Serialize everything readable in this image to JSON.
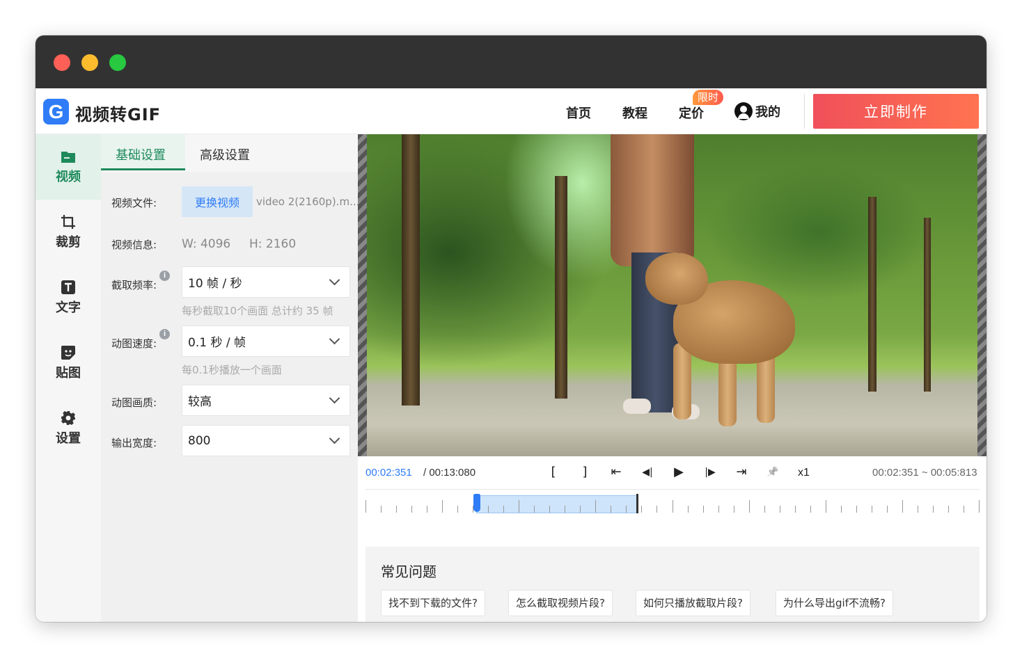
{
  "app": {
    "logo_letter": "G",
    "name": "视频转GIF"
  },
  "nav": {
    "home": "首页",
    "tutorial": "教程",
    "pricing": "定价",
    "pricing_badge": "限时",
    "mine": "我的",
    "cta": "立即制作"
  },
  "rail": [
    {
      "label": "视频",
      "icon": "folder-icon",
      "active": true
    },
    {
      "label": "裁剪",
      "icon": "crop-icon"
    },
    {
      "label": "文字",
      "icon": "text-icon"
    },
    {
      "label": "贴图",
      "icon": "sticker-icon"
    },
    {
      "label": "设置",
      "icon": "gear-icon"
    }
  ],
  "tabs": {
    "basic": "基础设置",
    "advanced": "高级设置"
  },
  "form": {
    "video_file_label": "视频文件:",
    "change_video": "更换视频",
    "filename": "video 2(2160p).m...",
    "video_info_label": "视频信息:",
    "width": "W:  4096",
    "height": "H:  2160",
    "fps_label": "截取频率:",
    "fps_value": "10 帧 / 秒",
    "fps_hint": "每秒截取10个画面   总计约 35 帧",
    "speed_label": "动图速度:",
    "speed_value": "0.1 秒 / 帧",
    "speed_hint": "每0.1秒播放一个画面",
    "quality_label": "动图画质:",
    "quality_value": "较高",
    "width_label": "输出宽度:",
    "width_value": "800"
  },
  "player": {
    "current_time": "00:02:351",
    "total_time": "/ 00:13:080",
    "mark_in": "[",
    "mark_out": "]",
    "jump_in": "⇤",
    "step_back": "◀|",
    "play": "▶",
    "step_fwd": "|▶",
    "jump_out": "⇥",
    "pin": "📌",
    "speed": "x1",
    "range": "00:02:351 ~ 00:05:813",
    "selection_start_fraction": 0.18,
    "selection_end_fraction": 0.443
  },
  "faq": {
    "title": "常见问题",
    "items": [
      "找不到下载的文件?",
      "怎么截取视频片段?",
      "如何只播放截取片段?",
      "为什么导出gif不流畅?"
    ]
  },
  "colors": {
    "accent_green": "#1e8a5c",
    "accent_blue": "#2f7cf6",
    "cta_red": "#f0505a"
  }
}
